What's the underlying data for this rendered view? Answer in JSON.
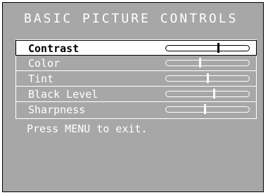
{
  "osd": {
    "title": "BASIC PICTURE CONTROLS",
    "items": [
      {
        "label": "Contrast",
        "level": 0.63,
        "selected": true
      },
      {
        "label": "Color",
        "level": 0.41,
        "selected": false
      },
      {
        "label": "Tint",
        "level": 0.5,
        "selected": false
      },
      {
        "label": "Black Level",
        "level": 0.58,
        "selected": false
      },
      {
        "label": "Sharpness",
        "level": 0.47,
        "selected": false
      }
    ],
    "hint": "Press MENU to exit."
  },
  "colors": {
    "background": "#a7a7a7",
    "text": "#ffffff",
    "selected_background": "#ffffff",
    "selected_text": "#000000"
  }
}
